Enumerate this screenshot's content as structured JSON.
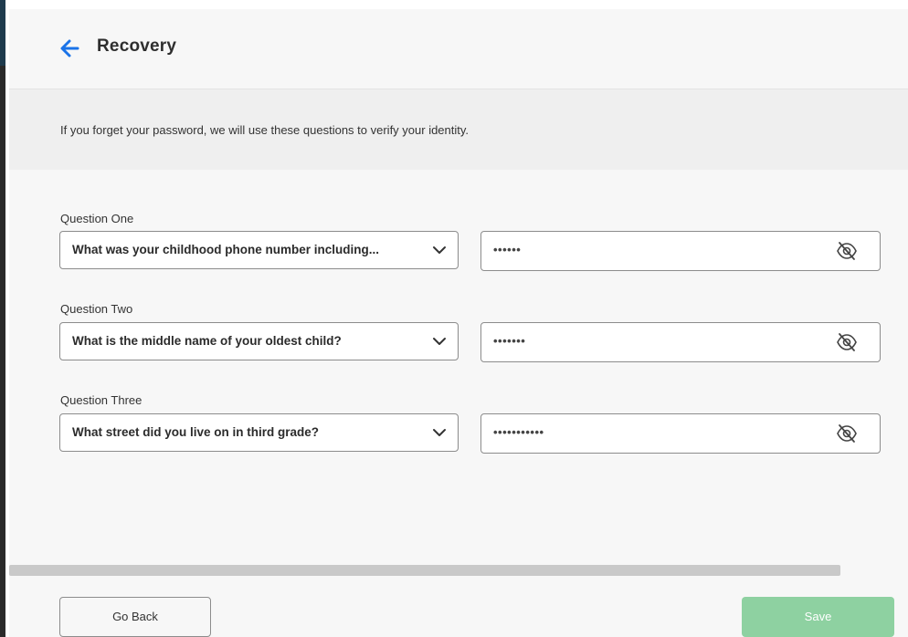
{
  "header": {
    "title": "Recovery",
    "back_icon": "arrow-left-icon"
  },
  "info": {
    "text": "If you forget your password, we will use these questions to verify your identity."
  },
  "questions": [
    {
      "label": "Question One",
      "selected": "What was your childhood phone number including...",
      "answer_masked": "••••••"
    },
    {
      "label": "Question Two",
      "selected": "What is the middle name of your oldest child?",
      "answer_masked": "•••••••"
    },
    {
      "label": "Question Three",
      "selected": "What street did you live on in third grade?",
      "answer_masked": "•••••••••••"
    }
  ],
  "footer": {
    "back_label": "Go Back",
    "save_label": "Save"
  },
  "colors": {
    "accent": "#1a73e8",
    "save_button": "#8ed1a1",
    "panel_bg": "#f7f7f7",
    "info_bg": "#efefef"
  }
}
